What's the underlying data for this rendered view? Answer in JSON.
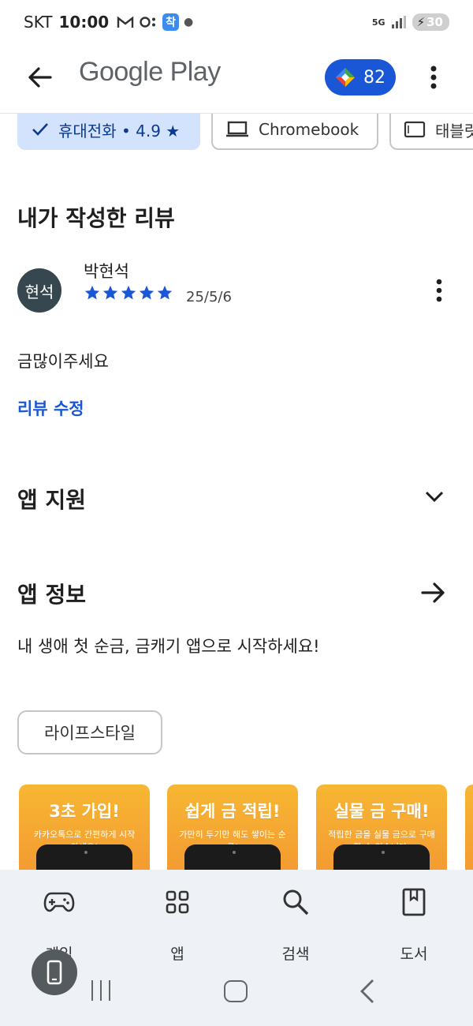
{
  "status_bar": {
    "carrier": "SKT",
    "time": "10:00",
    "kakao_badge": "착",
    "network": "5G",
    "battery": "30"
  },
  "app_bar": {
    "title": "Google Play",
    "points": "82"
  },
  "device_chips": [
    {
      "label": "휴대전화 • 4.9 ★",
      "icon": "check-icon",
      "selected": true
    },
    {
      "label": "Chromebook",
      "icon": "laptop-icon",
      "selected": false
    },
    {
      "label": "태블릿",
      "icon": "tablet-icon",
      "selected": false
    }
  ],
  "my_review": {
    "title": "내가 작성한 리뷰",
    "avatar_text": "현석",
    "reviewer": "박현석",
    "rating": 5,
    "date": "25/5/6",
    "text": "금많이주세요",
    "edit_label": "리뷰 수정"
  },
  "app_support": {
    "title": "앱 지원"
  },
  "app_info": {
    "title": "앱 정보",
    "description": "내 생애 첫 순금, 금캐기 앱으로 시작하세요!",
    "category": "라이프스타일"
  },
  "screenshots": [
    {
      "title": "3초 가입!",
      "subtitle": "카카오톡으로 간편하게 시작하세요!"
    },
    {
      "title": "쉽게 금 적립!",
      "subtitle": "가만히 두기만 해도 쌓이는 순금!"
    },
    {
      "title": "실물 금 구매!",
      "subtitle": "적립한 금을 실물 금으로 구매 할 수 있습니다."
    }
  ],
  "bottom_nav": {
    "games": "게임",
    "apps": "앱",
    "search": "검색",
    "books": "도서"
  },
  "colors": {
    "accent": "#1a57d6",
    "chip_selected_bg": "#d3e3fd",
    "avatar_bg": "#37474f",
    "screenshot_bg": "#f29030",
    "nav_bg": "#eef1f6"
  }
}
